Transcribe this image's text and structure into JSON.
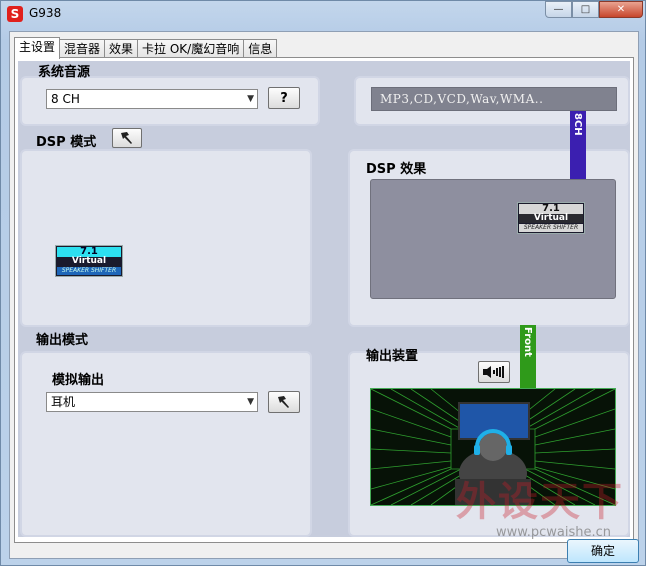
{
  "window": {
    "title": "G938",
    "logo_letter": "S",
    "controls": {
      "minimize": "—",
      "maximize": "□",
      "close": "✕"
    }
  },
  "tabs": [
    {
      "label": "主设置",
      "active": true
    },
    {
      "label": "混音器",
      "active": false
    },
    {
      "label": "效果",
      "active": false
    },
    {
      "label": "卡拉 OK/魔幻音响",
      "active": false
    },
    {
      "label": "信息",
      "active": false
    }
  ],
  "system_source": {
    "heading": "系统音源",
    "channel_select": "8 CH",
    "help_label": "?",
    "formats": "MP3,CD,VCD,Wav,WMA.."
  },
  "dsp_mode": {
    "heading": "DSP 模式",
    "badge": {
      "top": "7.1",
      "mid": "Virtual",
      "bottom": "SPEAKER SHIFTER"
    }
  },
  "dsp_effect": {
    "heading": "DSP 效果",
    "badge": {
      "top": "7.1",
      "mid": "Virtual",
      "bottom": "SPEAKER SHIFTER"
    },
    "strip_top": "8CH",
    "strip_bottom": "Front"
  },
  "output_mode": {
    "heading": "输出模式",
    "sub_heading": "模拟输出",
    "device_select": "耳机"
  },
  "output_device": {
    "heading": "输出装置"
  },
  "footer": {
    "ok_label": "确定"
  },
  "watermark": {
    "text": "外设天下",
    "url": "www.pcwaishe.cn"
  },
  "colors": {
    "strip_top": "#3b1fb0",
    "strip_bottom": "#2f9a1a",
    "badge_cyan": "#2de0f0"
  }
}
